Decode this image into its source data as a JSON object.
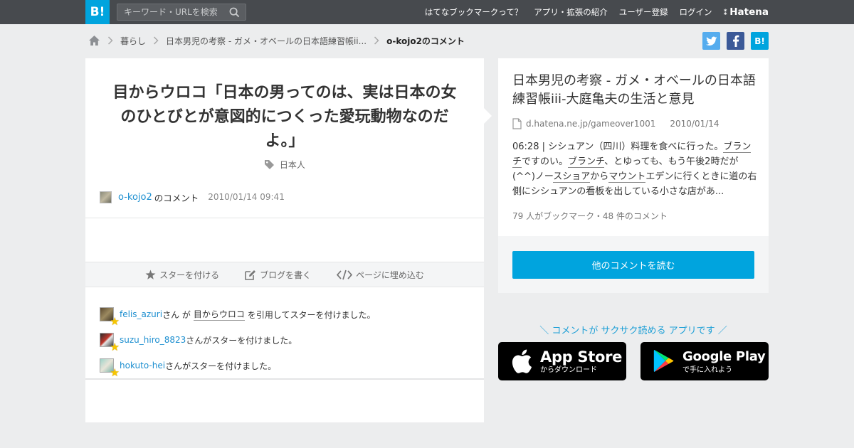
{
  "header": {
    "logo": "B!",
    "search_placeholder": "キーワード・URLを検索",
    "nav": [
      "はてなブックマークって？",
      "アプリ・拡張の紹介",
      "ユーザー登録",
      "ログイン"
    ],
    "brand": "Hatena"
  },
  "breadcrumb": {
    "items": [
      "暮らし",
      "日本男児の考察 - ガメ・オベールの日本語練習帳ii..."
    ],
    "current": "o-kojo2のコメント"
  },
  "share": {
    "twitter": "t",
    "facebook": "f",
    "hatebu": "B!"
  },
  "comment": {
    "quote": "目からウロコ「日本の男ってのは、実は日本の女のひとびとが意図的につくった愛玩動物なのだよ。」",
    "tag": "日本人",
    "user": "o-kojo2",
    "user_suffix": "のコメント",
    "date": "2010/01/14 09:41"
  },
  "actions": {
    "star": "スターを付ける",
    "blog": "ブログを書く",
    "embed": "ページに埋め込む"
  },
  "stars": [
    {
      "user": "felis_azuri",
      "san": "さん が",
      "quoted": "目からウロコ",
      "text": "を引用してスターを付けました。"
    },
    {
      "user": "suzu_hiro_8823",
      "san": "さん",
      "quoted": "",
      "text": "がスターを付けました。"
    },
    {
      "user": "hokuto-hei",
      "san": "さん",
      "quoted": "",
      "text": "がスターを付けました。"
    }
  ],
  "entry": {
    "title": "日本男児の考察 - ガメ・オベールの日本語練習帳iii-大庭亀夫の生活と意見",
    "domain": "d.hatena.ne.jp/gameover1001",
    "date": "2010/01/14",
    "summary_parts": [
      "06:28 | シシュアン（四川）料理を食べに行った。",
      "ブランチ",
      "ですのい。",
      "ブランチ",
      "、とゆっても、もう午後2時だが(^^)ノー",
      "スショア",
      "から",
      "マウント",
      "エデンに行くときに道の右側にシシュアンの看板を出している小さな店があ..."
    ],
    "counts": "79 人がブックマーク・48 件のコメント",
    "read_button": "他のコメントを読む"
  },
  "apps": {
    "promo": "＼ コメントが サクサク読める アプリです ／",
    "apple_big": "App Store",
    "apple_small": "からダウンロード",
    "google_big": "Google Play",
    "google_small": "で手に入れよう"
  },
  "colors": {
    "accent": "#00a4de",
    "link": "#1d8fd0",
    "topbar": "#474a4e"
  }
}
